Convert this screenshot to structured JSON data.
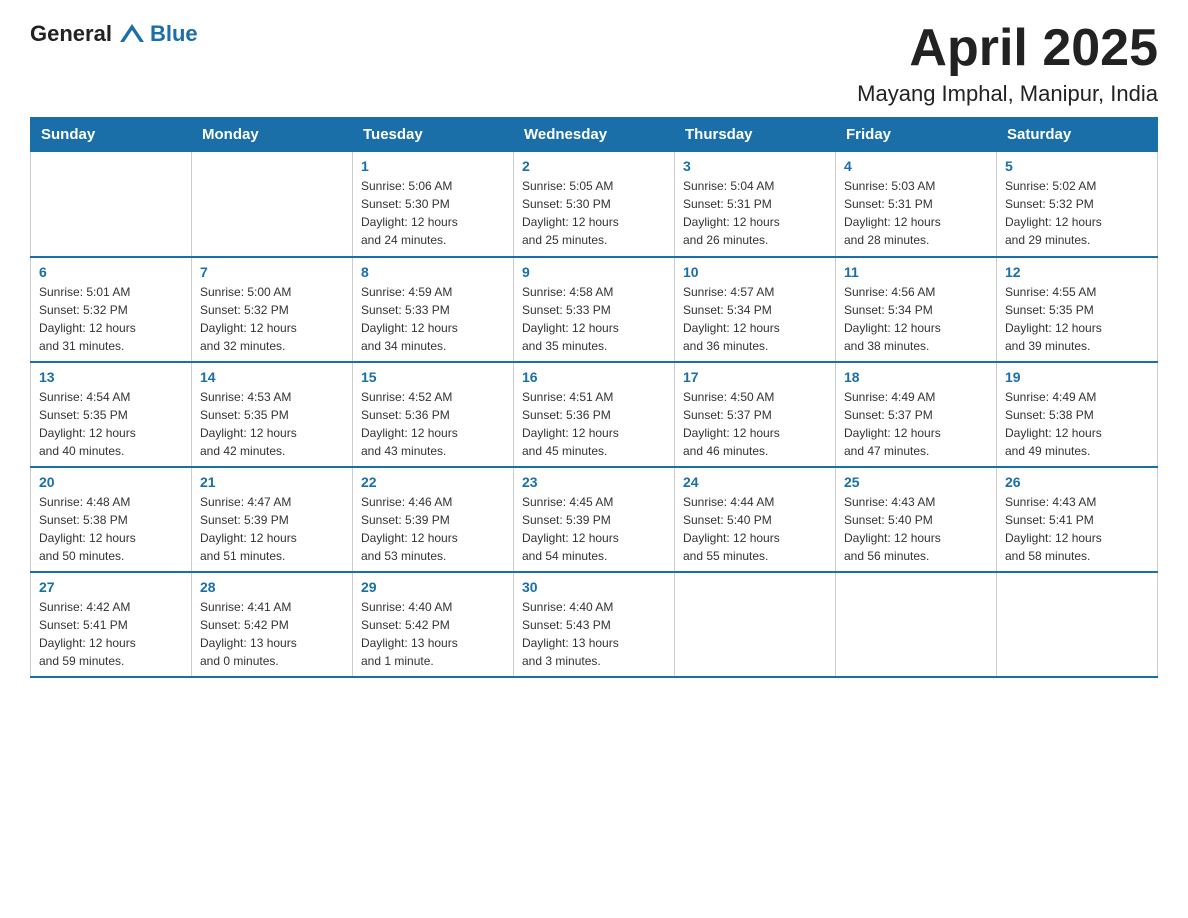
{
  "header": {
    "logo_general": "General",
    "logo_blue": "Blue",
    "title": "April 2025",
    "subtitle": "Mayang Imphal, Manipur, India"
  },
  "calendar": {
    "weekdays": [
      "Sunday",
      "Monday",
      "Tuesday",
      "Wednesday",
      "Thursday",
      "Friday",
      "Saturday"
    ],
    "weeks": [
      [
        {
          "day": "",
          "info": ""
        },
        {
          "day": "",
          "info": ""
        },
        {
          "day": "1",
          "info": "Sunrise: 5:06 AM\nSunset: 5:30 PM\nDaylight: 12 hours\nand 24 minutes."
        },
        {
          "day": "2",
          "info": "Sunrise: 5:05 AM\nSunset: 5:30 PM\nDaylight: 12 hours\nand 25 minutes."
        },
        {
          "day": "3",
          "info": "Sunrise: 5:04 AM\nSunset: 5:31 PM\nDaylight: 12 hours\nand 26 minutes."
        },
        {
          "day": "4",
          "info": "Sunrise: 5:03 AM\nSunset: 5:31 PM\nDaylight: 12 hours\nand 28 minutes."
        },
        {
          "day": "5",
          "info": "Sunrise: 5:02 AM\nSunset: 5:32 PM\nDaylight: 12 hours\nand 29 minutes."
        }
      ],
      [
        {
          "day": "6",
          "info": "Sunrise: 5:01 AM\nSunset: 5:32 PM\nDaylight: 12 hours\nand 31 minutes."
        },
        {
          "day": "7",
          "info": "Sunrise: 5:00 AM\nSunset: 5:32 PM\nDaylight: 12 hours\nand 32 minutes."
        },
        {
          "day": "8",
          "info": "Sunrise: 4:59 AM\nSunset: 5:33 PM\nDaylight: 12 hours\nand 34 minutes."
        },
        {
          "day": "9",
          "info": "Sunrise: 4:58 AM\nSunset: 5:33 PM\nDaylight: 12 hours\nand 35 minutes."
        },
        {
          "day": "10",
          "info": "Sunrise: 4:57 AM\nSunset: 5:34 PM\nDaylight: 12 hours\nand 36 minutes."
        },
        {
          "day": "11",
          "info": "Sunrise: 4:56 AM\nSunset: 5:34 PM\nDaylight: 12 hours\nand 38 minutes."
        },
        {
          "day": "12",
          "info": "Sunrise: 4:55 AM\nSunset: 5:35 PM\nDaylight: 12 hours\nand 39 minutes."
        }
      ],
      [
        {
          "day": "13",
          "info": "Sunrise: 4:54 AM\nSunset: 5:35 PM\nDaylight: 12 hours\nand 40 minutes."
        },
        {
          "day": "14",
          "info": "Sunrise: 4:53 AM\nSunset: 5:35 PM\nDaylight: 12 hours\nand 42 minutes."
        },
        {
          "day": "15",
          "info": "Sunrise: 4:52 AM\nSunset: 5:36 PM\nDaylight: 12 hours\nand 43 minutes."
        },
        {
          "day": "16",
          "info": "Sunrise: 4:51 AM\nSunset: 5:36 PM\nDaylight: 12 hours\nand 45 minutes."
        },
        {
          "day": "17",
          "info": "Sunrise: 4:50 AM\nSunset: 5:37 PM\nDaylight: 12 hours\nand 46 minutes."
        },
        {
          "day": "18",
          "info": "Sunrise: 4:49 AM\nSunset: 5:37 PM\nDaylight: 12 hours\nand 47 minutes."
        },
        {
          "day": "19",
          "info": "Sunrise: 4:49 AM\nSunset: 5:38 PM\nDaylight: 12 hours\nand 49 minutes."
        }
      ],
      [
        {
          "day": "20",
          "info": "Sunrise: 4:48 AM\nSunset: 5:38 PM\nDaylight: 12 hours\nand 50 minutes."
        },
        {
          "day": "21",
          "info": "Sunrise: 4:47 AM\nSunset: 5:39 PM\nDaylight: 12 hours\nand 51 minutes."
        },
        {
          "day": "22",
          "info": "Sunrise: 4:46 AM\nSunset: 5:39 PM\nDaylight: 12 hours\nand 53 minutes."
        },
        {
          "day": "23",
          "info": "Sunrise: 4:45 AM\nSunset: 5:39 PM\nDaylight: 12 hours\nand 54 minutes."
        },
        {
          "day": "24",
          "info": "Sunrise: 4:44 AM\nSunset: 5:40 PM\nDaylight: 12 hours\nand 55 minutes."
        },
        {
          "day": "25",
          "info": "Sunrise: 4:43 AM\nSunset: 5:40 PM\nDaylight: 12 hours\nand 56 minutes."
        },
        {
          "day": "26",
          "info": "Sunrise: 4:43 AM\nSunset: 5:41 PM\nDaylight: 12 hours\nand 58 minutes."
        }
      ],
      [
        {
          "day": "27",
          "info": "Sunrise: 4:42 AM\nSunset: 5:41 PM\nDaylight: 12 hours\nand 59 minutes."
        },
        {
          "day": "28",
          "info": "Sunrise: 4:41 AM\nSunset: 5:42 PM\nDaylight: 13 hours\nand 0 minutes."
        },
        {
          "day": "29",
          "info": "Sunrise: 4:40 AM\nSunset: 5:42 PM\nDaylight: 13 hours\nand 1 minute."
        },
        {
          "day": "30",
          "info": "Sunrise: 4:40 AM\nSunset: 5:43 PM\nDaylight: 13 hours\nand 3 minutes."
        },
        {
          "day": "",
          "info": ""
        },
        {
          "day": "",
          "info": ""
        },
        {
          "day": "",
          "info": ""
        }
      ]
    ]
  }
}
